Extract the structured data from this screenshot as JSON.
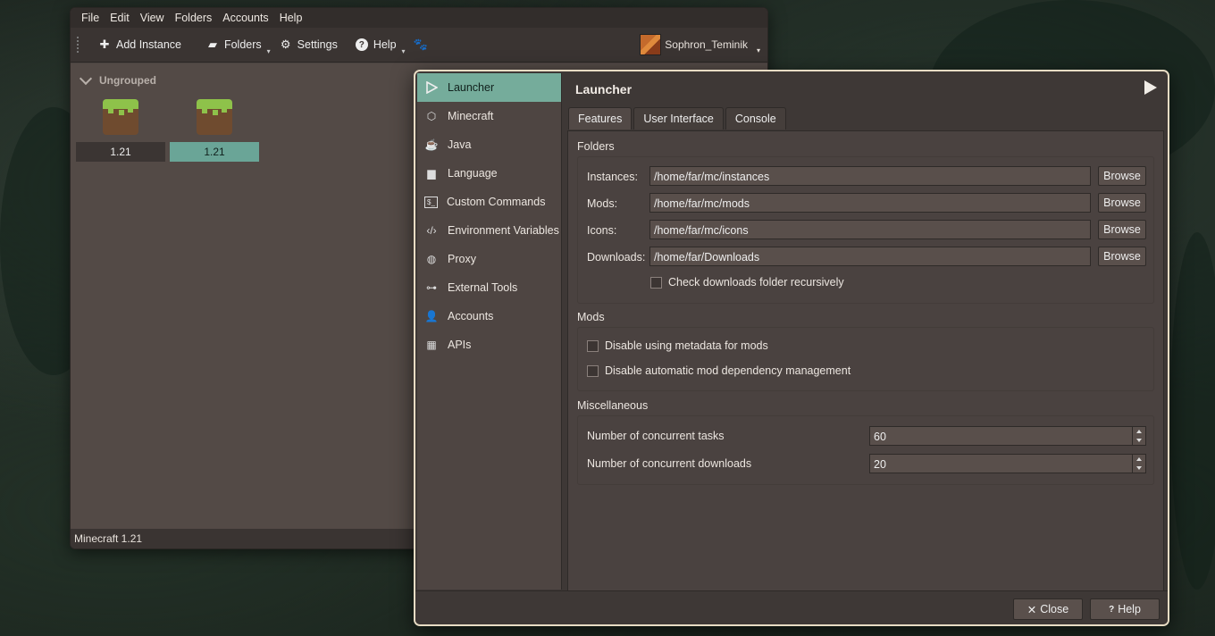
{
  "main_window": {
    "menu": [
      "File",
      "Edit",
      "View",
      "Folders",
      "Accounts",
      "Help"
    ],
    "toolbar": {
      "add_instance": "Add Instance",
      "folders": "Folders",
      "settings": "Settings",
      "help": "Help",
      "account_name": "Sophron_Teminik"
    },
    "group_name": "Ungrouped",
    "instances": [
      {
        "label": "1.21",
        "selected": false
      },
      {
        "label": "1.21",
        "selected": true
      }
    ],
    "status": "Minecraft 1.21"
  },
  "settings": {
    "sidebar": [
      {
        "label": "Launcher",
        "icon": "play-icon",
        "active": true
      },
      {
        "label": "Minecraft",
        "icon": "cube-icon"
      },
      {
        "label": "Java",
        "icon": "coffee-icon"
      },
      {
        "label": "Language",
        "icon": "speech-bubble-icon"
      },
      {
        "label": "Custom Commands",
        "icon": "terminal-icon"
      },
      {
        "label": "Environment Variables",
        "icon": "code-icon"
      },
      {
        "label": "Proxy",
        "icon": "globe-icon"
      },
      {
        "label": "External Tools",
        "icon": "link-icon"
      },
      {
        "label": "Accounts",
        "icon": "user-icon"
      },
      {
        "label": "APIs",
        "icon": "apps-icon"
      }
    ],
    "page_title": "Launcher",
    "tabs": [
      "Features",
      "User Interface",
      "Console"
    ],
    "folders": {
      "title": "Folders",
      "instances_label": "Instances:",
      "instances_value": "/home/far/mc/instances",
      "mods_label": "Mods:",
      "mods_value": "/home/far/mc/mods",
      "icons_label": "Icons:",
      "icons_value": "/home/far/mc/icons",
      "downloads_label": "Downloads:",
      "downloads_value": "/home/far/Downloads",
      "browse": "Browse",
      "recursive_label": "Check downloads folder recursively"
    },
    "mods": {
      "title": "Mods",
      "metadata_label": "Disable using metadata for mods",
      "dependency_label": "Disable automatic mod dependency management"
    },
    "misc": {
      "title": "Miscellaneous",
      "tasks_label": "Number of concurrent tasks",
      "tasks_value": "60",
      "downloads_label": "Number of concurrent downloads",
      "downloads_value": "20"
    },
    "buttons": {
      "close": "Close",
      "help": "Help"
    }
  }
}
